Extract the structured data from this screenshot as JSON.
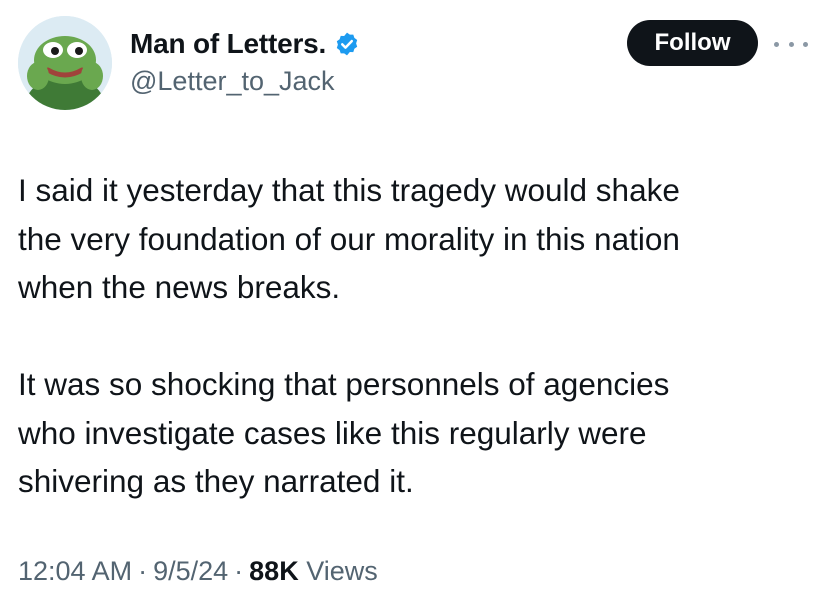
{
  "author": {
    "display_name": "Man of Letters.",
    "handle": "@Letter_to_Jack",
    "verified": true,
    "avatar_icon": "frog-avatar-icon",
    "verified_color": "#1d9bf0"
  },
  "actions": {
    "follow_label": "Follow",
    "more_icon": "more-options-icon"
  },
  "tweet": {
    "paragraphs": [
      [
        "I said it yesterday that this tragedy would shake",
        "the very foundation of our morality in this nation",
        "when the news breaks."
      ],
      [
        "It was so shocking that personnels of agencies",
        "who investigate cases like this regularly were",
        "shivering as they narrated it."
      ]
    ],
    "time": "12:04 AM",
    "date": "9/5/24",
    "view_count": "88K",
    "views_label": "Views",
    "separator": "·"
  }
}
